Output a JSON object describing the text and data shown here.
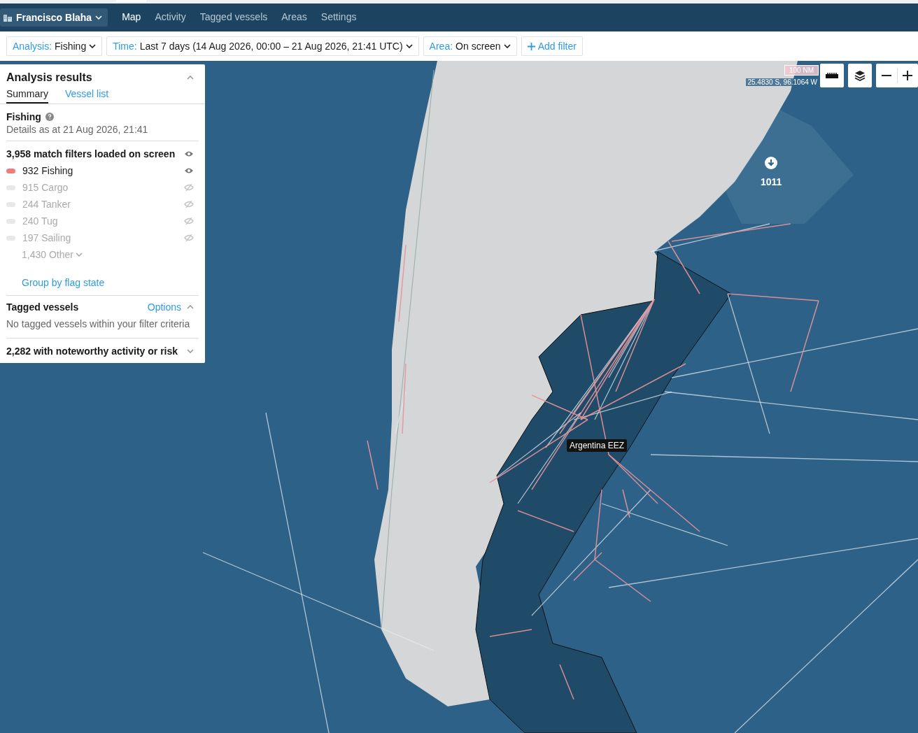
{
  "account": {
    "name": "Francisco Blaha"
  },
  "nav_tabs": [
    {
      "label": "Map",
      "selected": true
    },
    {
      "label": "Activity",
      "selected": false
    },
    {
      "label": "Tagged vessels",
      "selected": false
    },
    {
      "label": "Areas",
      "selected": false
    },
    {
      "label": "Settings",
      "selected": false
    }
  ],
  "filters": [
    {
      "key": "Analysis:",
      "value": "Fishing"
    },
    {
      "key": "Time:",
      "value": "Last 7 days (14 Aug 2026, 00:00 – 21 Aug 2026, 21:41 UTC)"
    },
    {
      "key": "Area:",
      "value": "On screen"
    }
  ],
  "add_filter": {
    "label": "Add filter"
  },
  "analysis_panel": {
    "title": "Analysis results",
    "expanded": true,
    "tabs": [
      {
        "label": "Summary",
        "selected": true
      },
      {
        "label": "Vessel list",
        "selected": false
      }
    ],
    "section_title": "Fishing",
    "details": "Details as at 21 Aug 2026, 21:41",
    "summary": "3,958 match filters loaded on screen",
    "categories": [
      {
        "label": "932 Fishing",
        "visible": true
      },
      {
        "label": "915 Cargo",
        "visible": false
      },
      {
        "label": "244 Tanker",
        "visible": false
      },
      {
        "label": "240 Tug",
        "visible": false
      },
      {
        "label": "197 Sailing",
        "visible": false
      }
    ],
    "other": {
      "label": "1,430 Other",
      "expanded": false
    },
    "group_link": "Group by flag state",
    "tagged": {
      "title": "Tagged vessels",
      "options": "Options",
      "expanded": true,
      "empty": "No tagged vessels within your filter criteria"
    },
    "noteworthy": {
      "label": "2,282 with noteworthy activity or risk",
      "expanded": false
    }
  },
  "map": {
    "scale": "100 NM",
    "coordinates": "25.4830 S, 96.1064 W",
    "cluster_count": "1011",
    "area_label": "Argentina EEZ"
  }
}
